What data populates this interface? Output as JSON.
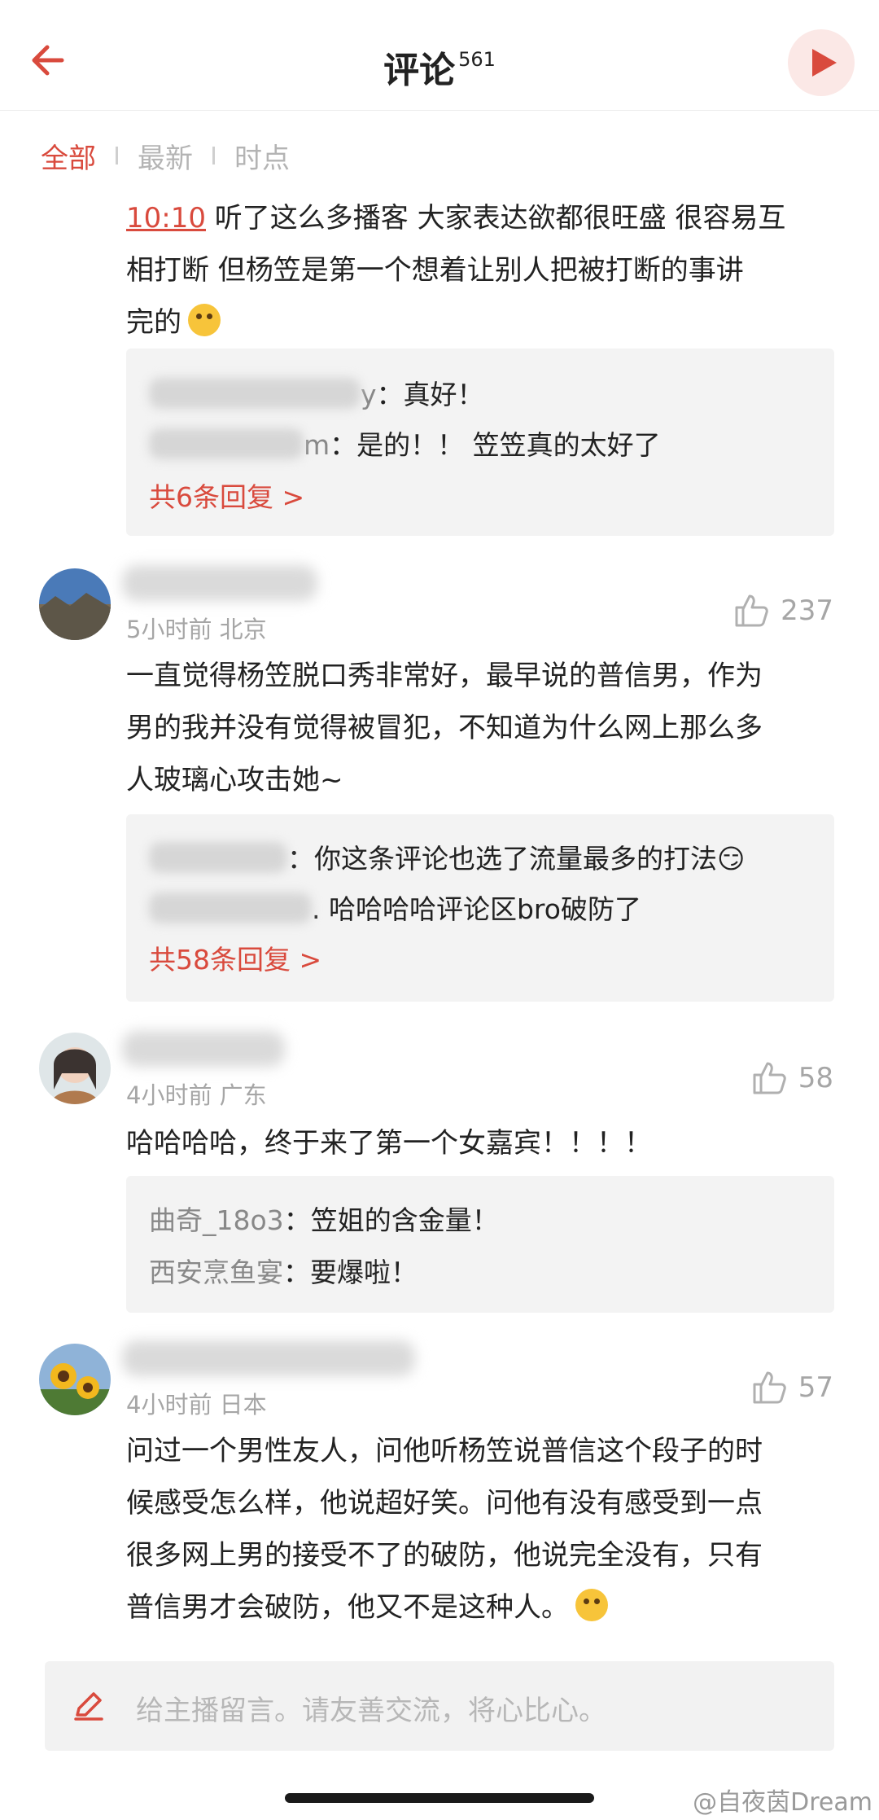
{
  "header": {
    "title": "评论",
    "count": "561"
  },
  "tabs": [
    {
      "label": "全部",
      "active": true
    },
    {
      "label": "最新",
      "active": false
    },
    {
      "label": "时点",
      "active": false
    }
  ],
  "comment0": {
    "timestamp": "10:10",
    "text_line1": " 听了这么多播客 大家表达欲都很旺盛 很容易互",
    "text_line2": "相打断 但杨笠是第一个想着让别人把被打断的事讲",
    "text_line3": "完的",
    "replies": [
      {
        "name_suffix": "y",
        "text": "：真好！"
      },
      {
        "name_suffix": "m",
        "text": "：是的！！ 笠笠真的太好了"
      }
    ],
    "more": "共6条回复 >"
  },
  "comment1": {
    "meta": "5小时前 北京",
    "likes": "237",
    "text_line1": "一直觉得杨笠脱口秀非常好，最早说的普信男，作为",
    "text_line2": "男的我并没有觉得被冒犯，不知道为什么网上那么多",
    "text_line3": "人玻璃心攻击她~",
    "replies": [
      {
        "name_suffix": "",
        "text": "：你这条评论也选了流量最多的打法😏"
      },
      {
        "name_suffix": "",
        "text": ". 哈哈哈哈评论区bro破防了"
      }
    ],
    "more": "共58条回复 >"
  },
  "comment2": {
    "meta": "4小时前 广东",
    "likes": "58",
    "text_line1": "哈哈哈哈，终于来了第一个女嘉宾！！！！",
    "replies": [
      {
        "name": "曲奇_18o3",
        "text": "：笠姐的含金量！"
      },
      {
        "name": "西安烹鱼宴",
        "text": "：要爆啦！"
      }
    ]
  },
  "comment3": {
    "meta": "4小时前 日本",
    "likes": "57",
    "text_line1": "问过一个男性友人，问他听杨笠说普信这个段子的时",
    "text_line2": "候感受怎么样，他说超好笑。问他有没有感受到一点",
    "text_line3": "很多网上男的接受不了的破防，他说完全没有，只有",
    "text_line4": "普信男才会破防，他又不是这种人。"
  },
  "input": {
    "placeholder": "给主播留言。请友善交流，将心比心。"
  },
  "watermark": "@自夜茵Dream",
  "colors": {
    "accent": "#d94a3d",
    "reply_bg": "#f3f3f3",
    "muted": "#a6a6a6"
  }
}
